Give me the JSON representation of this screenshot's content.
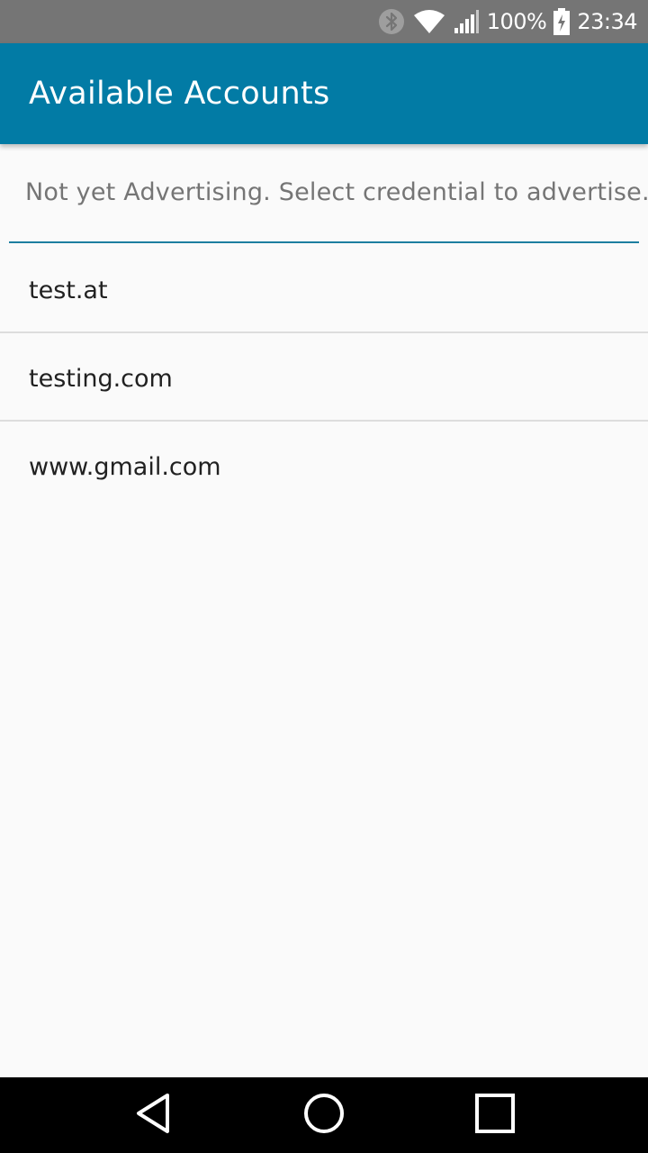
{
  "status_bar": {
    "battery_percent": "100%",
    "time": "23:34",
    "icons": [
      "bluetooth-icon",
      "wifi-icon",
      "signal-icon",
      "battery-charging-icon"
    ]
  },
  "app_bar": {
    "title": "Available Accounts",
    "color": "#027ba5"
  },
  "status_message": "Not yet Advertising. Select credential to advertise.",
  "accounts": [
    {
      "label": "test.at"
    },
    {
      "label": "testing.com"
    },
    {
      "label": "www.gmail.com"
    }
  ],
  "nav_bar": {
    "buttons": [
      "back-icon",
      "home-icon",
      "recents-icon"
    ]
  }
}
